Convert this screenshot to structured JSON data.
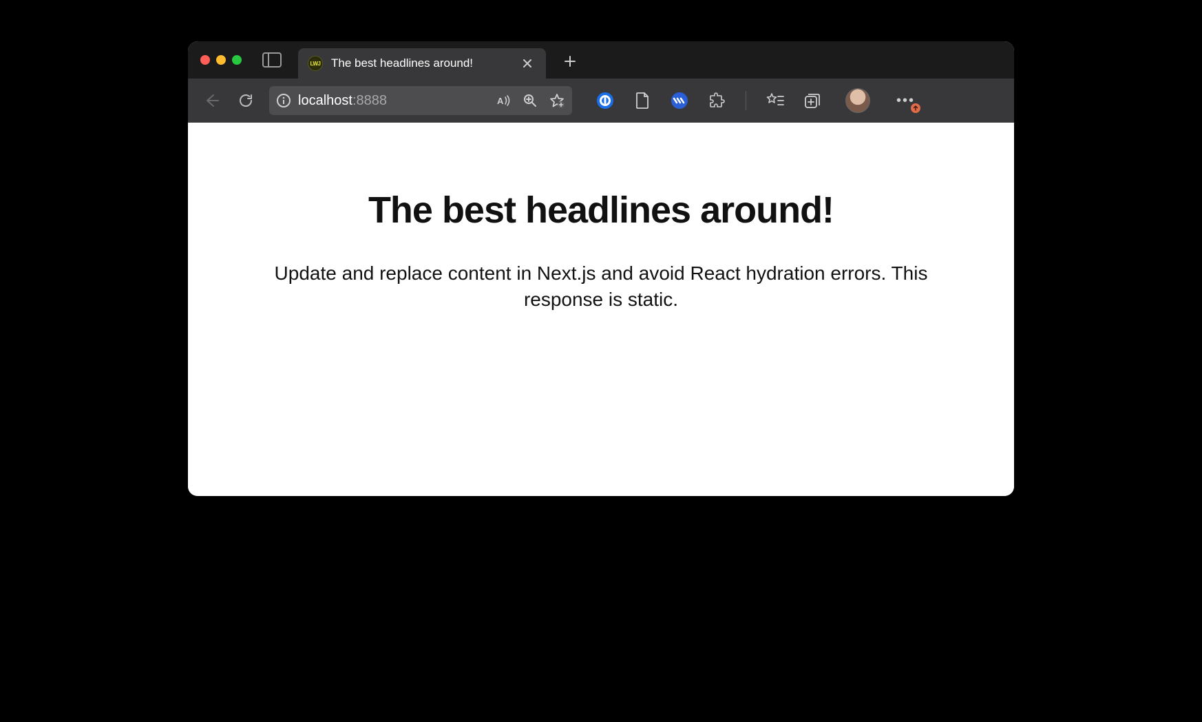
{
  "window": {
    "tab": {
      "favicon_text": "LWJ",
      "title": "The best headlines around!"
    }
  },
  "address_bar": {
    "host": "localhost",
    "port": ":8888"
  },
  "page": {
    "heading": "The best headlines around!",
    "body": "Update and replace content in Next.js and avoid React hydration errors. This response is static."
  }
}
